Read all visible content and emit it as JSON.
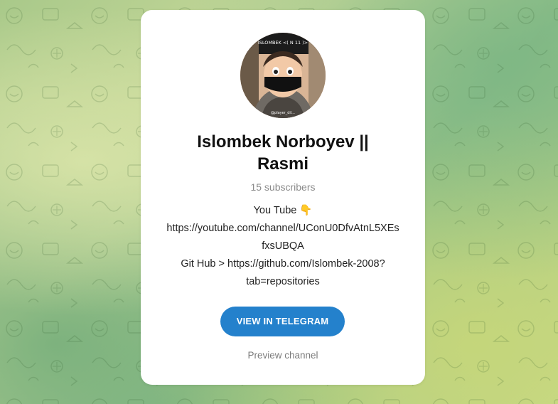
{
  "channel": {
    "name": "Islombek Norboyev || Rasmi",
    "subscribers": "15 subscribers",
    "avatar_caption": "ISLOMBEK <( N 11 )>",
    "avatar_watermark": "@player_dil..."
  },
  "description": {
    "line1": "You Tube 👇",
    "line2": "https://youtube.com/channel/UConU0DfvAtnL5XEs",
    "line3": "fxsUBQA",
    "line4": "Git Hub > https://github.com/Islombek-2008?",
    "line5": "tab=repositories"
  },
  "actions": {
    "view_label": "VIEW IN TELEGRAM",
    "preview_label": "Preview channel"
  },
  "colors": {
    "accent": "#2481cc",
    "background": "#a9c98a"
  }
}
